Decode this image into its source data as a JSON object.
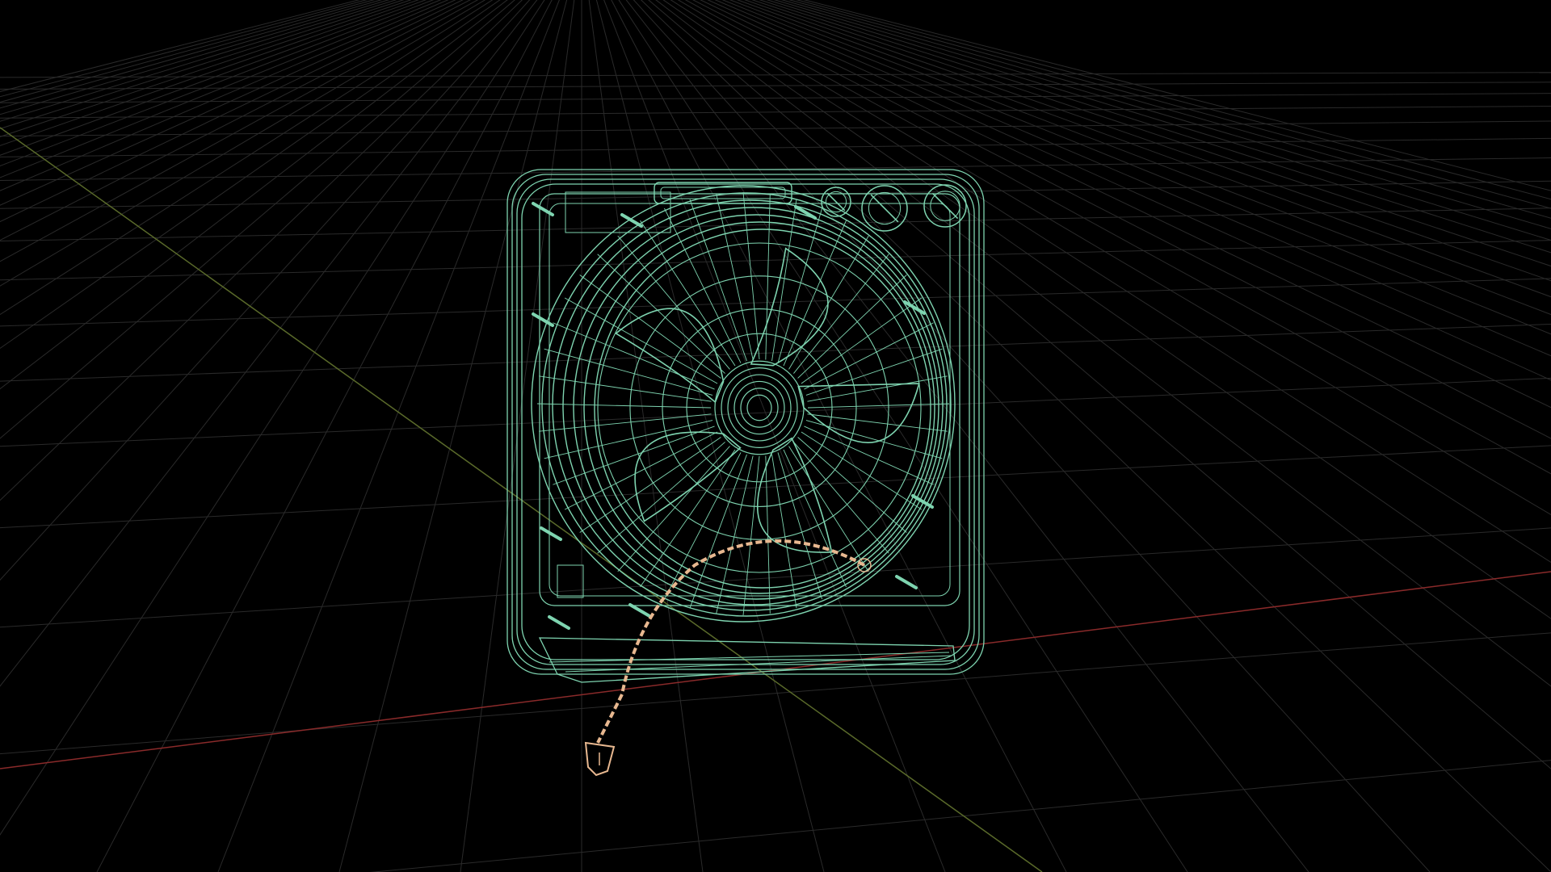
{
  "viewport": {
    "background": "#000000",
    "display_mode": "wireframe",
    "grid_visible": true
  },
  "grid": {
    "line_color": "#2a2a2a",
    "x_axis_color": "#8a2a2a",
    "z_axis_color": "#5a6a2a"
  },
  "model": {
    "object": "box-fan",
    "wire_color": "#7ed4b0",
    "selected_color": "#e8b890"
  }
}
